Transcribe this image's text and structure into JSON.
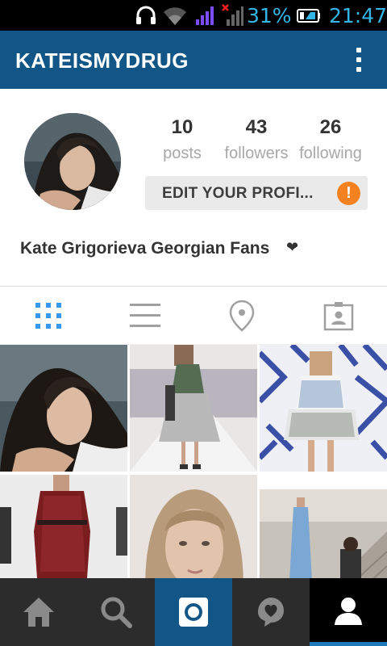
{
  "status_bar": {
    "battery_percent": "31%",
    "time": "21:47",
    "icons": [
      "headphones-icon",
      "wifi-icon",
      "signal-icon",
      "signal-no-service-icon",
      "battery-icon"
    ],
    "accent_color": "#33b5e5"
  },
  "app_bar": {
    "username": "KATEISMYDRUG",
    "background_color": "#125688",
    "menu_icon": "overflow-menu-icon"
  },
  "profile": {
    "stats": [
      {
        "value": "10",
        "label": "posts"
      },
      {
        "value": "43",
        "label": "followers"
      },
      {
        "value": "26",
        "label": "following"
      }
    ],
    "edit_button_label": "EDIT YOUR PROFI...",
    "alert_badge": "!",
    "alert_color": "#f5821f",
    "full_name": "Kate Grigorieva Georgian Fans",
    "name_suffix_glyph": "❤"
  },
  "tabs": [
    {
      "name": "grid",
      "icon": "grid-icon",
      "active": true
    },
    {
      "name": "list",
      "icon": "list-icon",
      "active": false
    },
    {
      "name": "places",
      "icon": "location-pin-icon",
      "active": false
    },
    {
      "name": "tagged",
      "icon": "tagged-photos-icon",
      "active": false
    }
  ],
  "grid": {
    "photos": [
      "portrait-photo",
      "runway-white-dress-photo",
      "patterned-dress-photo",
      "red-lace-coat-photo",
      "blonde-model-headshot-photo",
      "blue-gown-staircase-photo"
    ]
  },
  "bottom_nav": [
    {
      "name": "home",
      "icon": "home-icon"
    },
    {
      "name": "search",
      "icon": "search-icon"
    },
    {
      "name": "camera",
      "icon": "camera-icon"
    },
    {
      "name": "activity",
      "icon": "activity-heart-icon"
    },
    {
      "name": "profile",
      "icon": "profile-icon",
      "active": true
    }
  ]
}
